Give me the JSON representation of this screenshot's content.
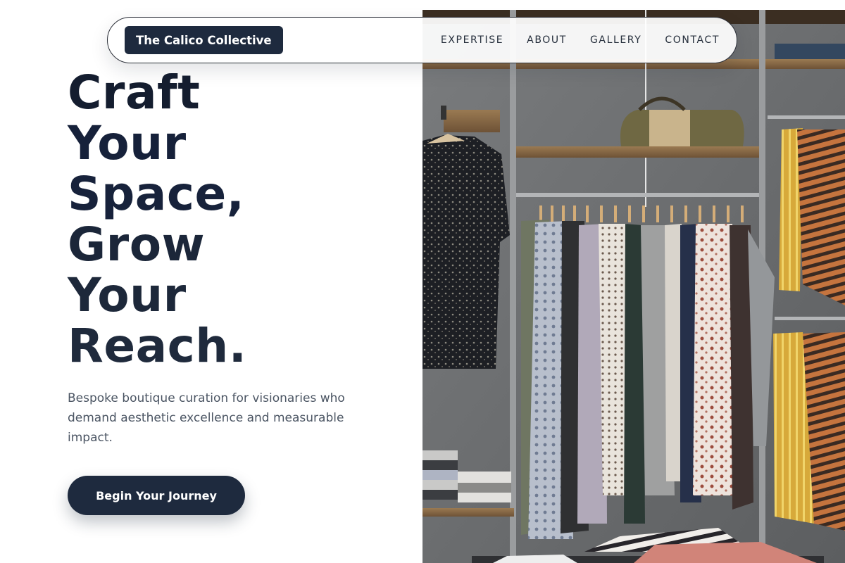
{
  "nav": {
    "brand": "The Calico Collective",
    "links": [
      "EXPERTISE",
      "ABOUT",
      "GALLERY",
      "CONTACT"
    ]
  },
  "hero": {
    "headline_lines": [
      "Craft",
      "Your",
      "Space,",
      "Grow",
      "Your",
      "Reach."
    ],
    "subtitle": "Bespoke boutique curation for visionaries who demand aesthetic excellence and measurable impact.",
    "cta_label": "Begin Your Journey"
  },
  "colors": {
    "primary_navy": "#1e2a3e",
    "headline": "#141d2f",
    "body_text": "#4b5563",
    "background": "#ffffff"
  },
  "image": {
    "alt": "Boutique clothing rack with dresses, striped shirts and a handbag on a shelf"
  }
}
